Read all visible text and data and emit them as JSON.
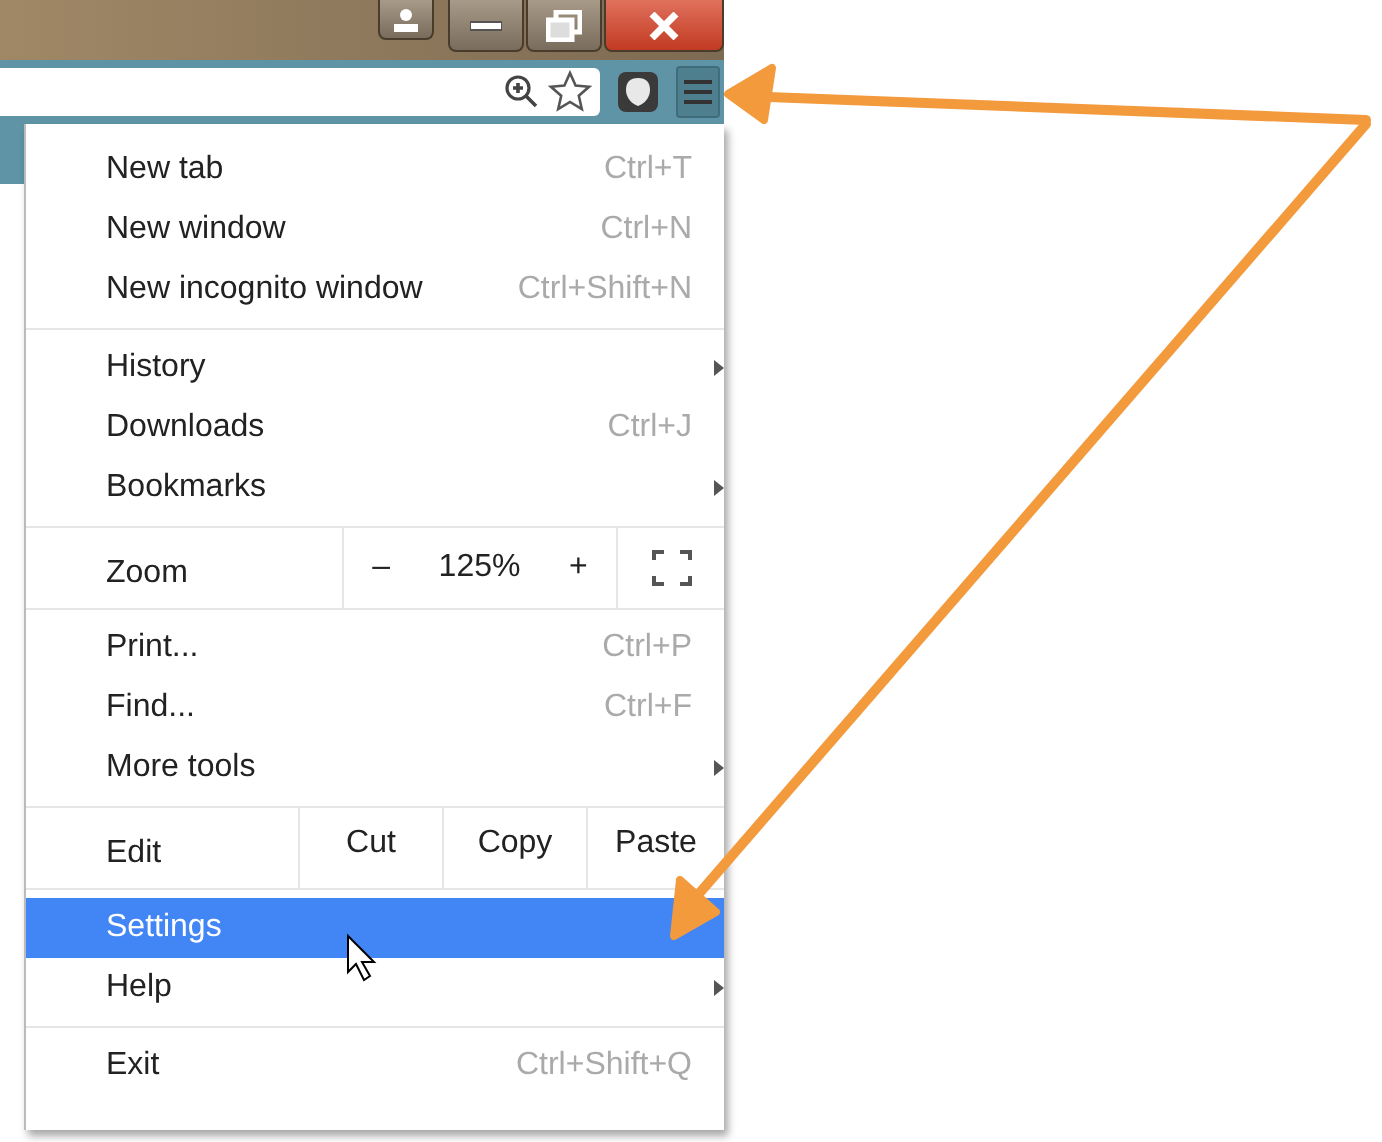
{
  "menu": {
    "sections": [
      {
        "items": [
          {
            "kind": "item",
            "label": "New tab",
            "shortcut": "Ctrl+T",
            "submenu": false,
            "selected": false
          },
          {
            "kind": "item",
            "label": "New window",
            "shortcut": "Ctrl+N",
            "submenu": false,
            "selected": false
          },
          {
            "kind": "item",
            "label": "New incognito window",
            "shortcut": "Ctrl+Shift+N",
            "submenu": false,
            "selected": false
          }
        ]
      },
      {
        "items": [
          {
            "kind": "item",
            "label": "History",
            "submenu": true,
            "selected": false
          },
          {
            "kind": "item",
            "label": "Downloads",
            "shortcut": "Ctrl+J",
            "submenu": false,
            "selected": false
          },
          {
            "kind": "item",
            "label": "Bookmarks",
            "submenu": true,
            "selected": false
          }
        ]
      },
      {
        "items": [
          {
            "kind": "zoom",
            "label": "Zoom",
            "minus": "–",
            "value": "125%",
            "plus": "+"
          }
        ]
      },
      {
        "items": [
          {
            "kind": "item",
            "label": "Print...",
            "shortcut": "Ctrl+P",
            "submenu": false,
            "selected": false
          },
          {
            "kind": "item",
            "label": "Find...",
            "shortcut": "Ctrl+F",
            "submenu": false,
            "selected": false
          },
          {
            "kind": "item",
            "label": "More tools",
            "submenu": true,
            "selected": false
          }
        ]
      },
      {
        "items": [
          {
            "kind": "edit",
            "label": "Edit",
            "actions": [
              "Cut",
              "Copy",
              "Paste"
            ]
          }
        ]
      },
      {
        "items": [
          {
            "kind": "item",
            "label": "Settings",
            "submenu": false,
            "selected": true
          },
          {
            "kind": "item",
            "label": "Help",
            "submenu": true,
            "selected": false
          }
        ]
      },
      {
        "items": [
          {
            "kind": "item",
            "label": "Exit",
            "shortcut": "Ctrl+Shift+Q",
            "submenu": false,
            "selected": false
          }
        ]
      }
    ]
  }
}
